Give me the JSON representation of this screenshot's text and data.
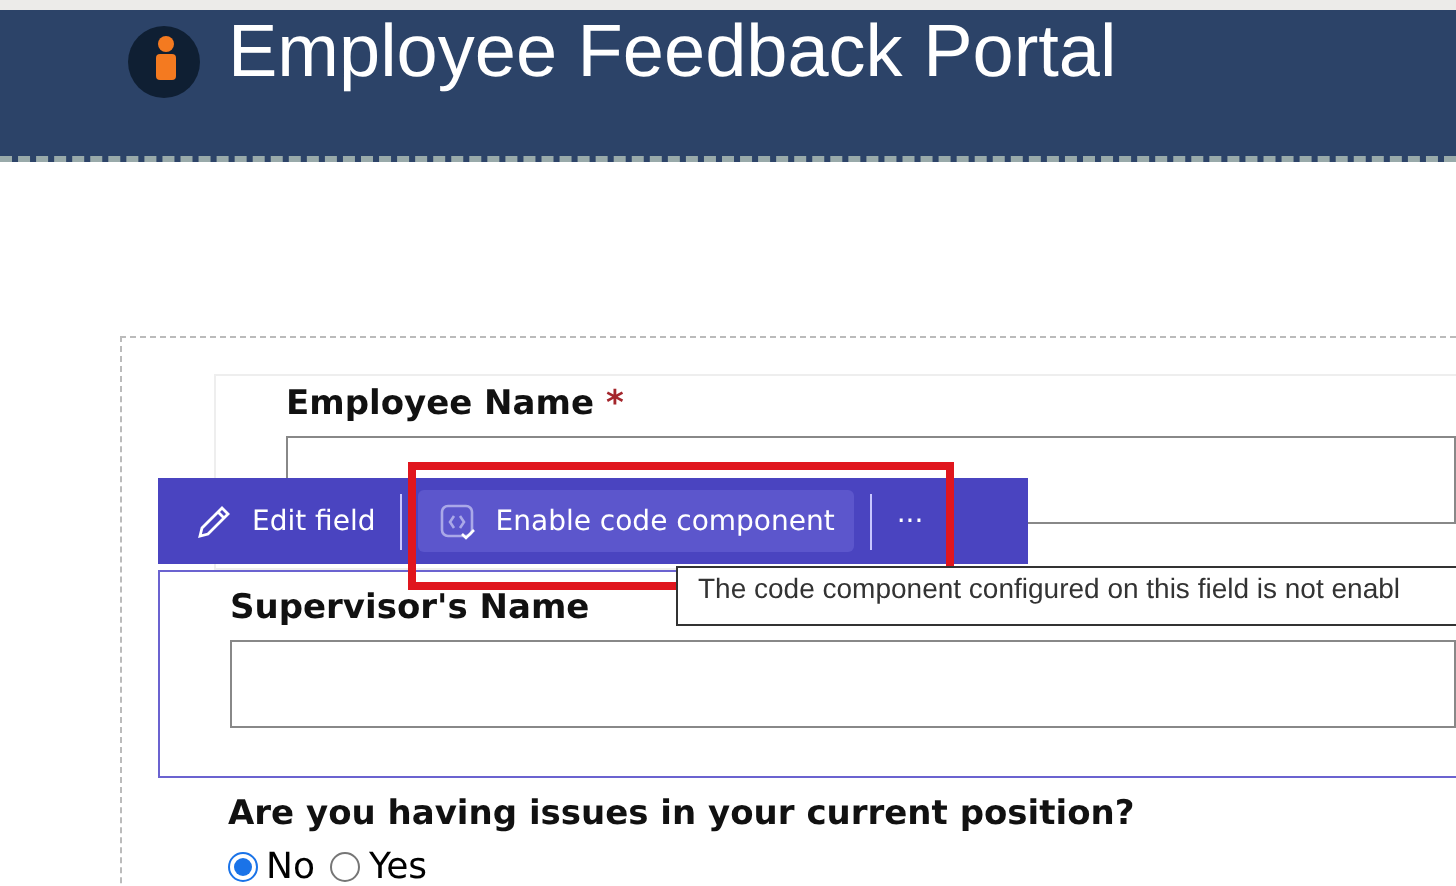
{
  "header": {
    "title": "Employee Feedback Portal"
  },
  "fields": [
    {
      "label": "Employee Name",
      "required": true
    },
    {
      "label": "Supervisor's Name",
      "required": false
    }
  ],
  "required_mark": "*",
  "toolbar": {
    "items": [
      {
        "kind": "edit",
        "label": "Edit field"
      },
      {
        "kind": "enable",
        "label": "Enable code component",
        "highlighted": true
      },
      {
        "kind": "more",
        "label": "···"
      }
    ]
  },
  "tooltip": "The code component configured on this field is not enabl",
  "question": {
    "label": "Are you having issues in your current position?",
    "options": [
      {
        "label": "No",
        "selected": true
      },
      {
        "label": "Yes",
        "selected": false
      }
    ]
  }
}
